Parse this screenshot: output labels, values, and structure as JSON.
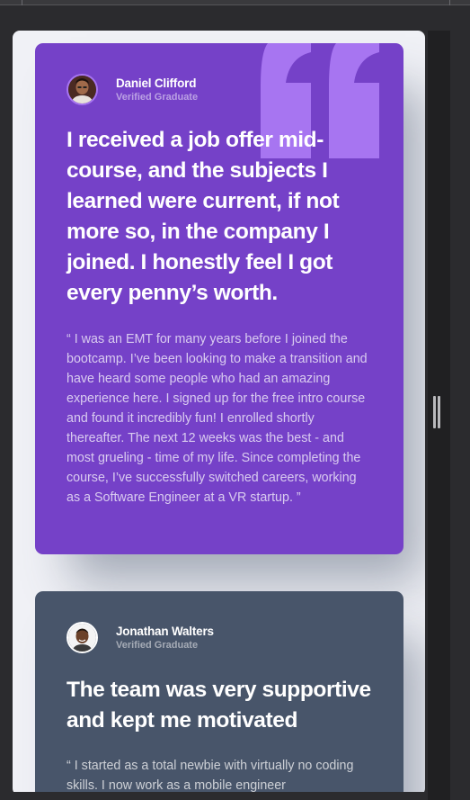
{
  "colors": {
    "purple": "#7541c8",
    "slate": "#48556a",
    "page_bg": "#f0f1f6",
    "quote_mark": "#a775f1"
  },
  "icons": {
    "quote": "quote-icon",
    "grip": "resize-grip-icon"
  },
  "testimonials": [
    {
      "name": "Daniel Clifford",
      "role": "Verified Graduate",
      "headline": "I received a job offer mid-course, and the subjects I learned were current, if not more so, in the company I joined. I honestly feel I got every penny’s worth.",
      "body": "“ I was an EMT for many years before I joined the bootcamp. I’ve been looking to make a transition and have heard some people who had an amazing experience here. I signed up for the free intro course and found it incredibly fun! I enrolled shortly thereafter. The next 12 weeks was the best - and most grueling - time of my life. Since completing the course, I’ve successfully switched careers, working as a Software Engineer at a VR startup. ”"
    },
    {
      "name": "Jonathan Walters",
      "role": "Verified Graduate",
      "headline": "The team was very supportive and kept me motivated",
      "body": "“ I started as a total newbie with virtually no coding skills. I now work as a mobile engineer"
    }
  ]
}
